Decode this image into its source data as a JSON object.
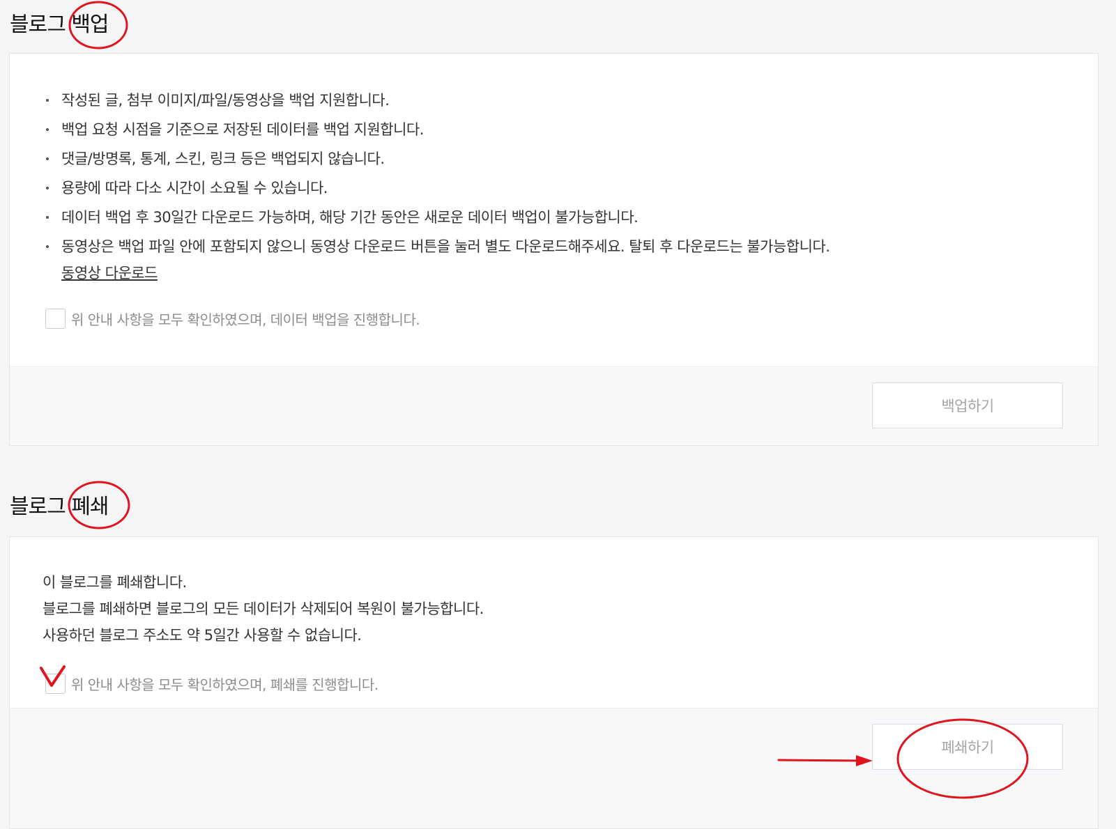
{
  "backup": {
    "title": "블로그 백업",
    "items": [
      "작성된 글, 첨부 이미지/파일/동영상을 백업 지원합니다.",
      "백업 요청 시점을 기준으로 저장된 데이터를 백업 지원합니다.",
      "댓글/방명록, 통계, 스킨, 링크 등은 백업되지 않습니다.",
      "용량에 따라 다소 시간이 소요될 수 있습니다.",
      "데이터 백업 후 30일간 다운로드 가능하며, 해당 기간 동안은 새로운 데이터 백업이 불가능합니다.",
      "동영상은 백업 파일 안에 포함되지 않으니 동영상 다운로드 버튼을 눌러 별도 다운로드해주세요. 탈퇴 후 다운로드는 불가능합니다."
    ],
    "video_link": "동영상 다운로드",
    "confirm_label": "위 안내 사항을 모두 확인하였으며, 데이터 백업을 진행합니다.",
    "button_label": "백업하기"
  },
  "close": {
    "title": "블로그 폐쇄",
    "lines": [
      "이 블로그를 폐쇄합니다.",
      "블로그를 폐쇄하면 블로그의 모든 데이터가 삭제되어 복원이 불가능합니다.",
      "사용하던 블로그 주소도 약 5일간 사용할 수 없습니다."
    ],
    "confirm_label": "위 안내 사항을 모두 확인하였으며, 폐쇄를 진행합니다.",
    "button_label": "폐쇄하기"
  },
  "colors": {
    "annotation": "#e0141e",
    "page_background": "#f4f5f7",
    "button_text": "#a2a4a8"
  }
}
